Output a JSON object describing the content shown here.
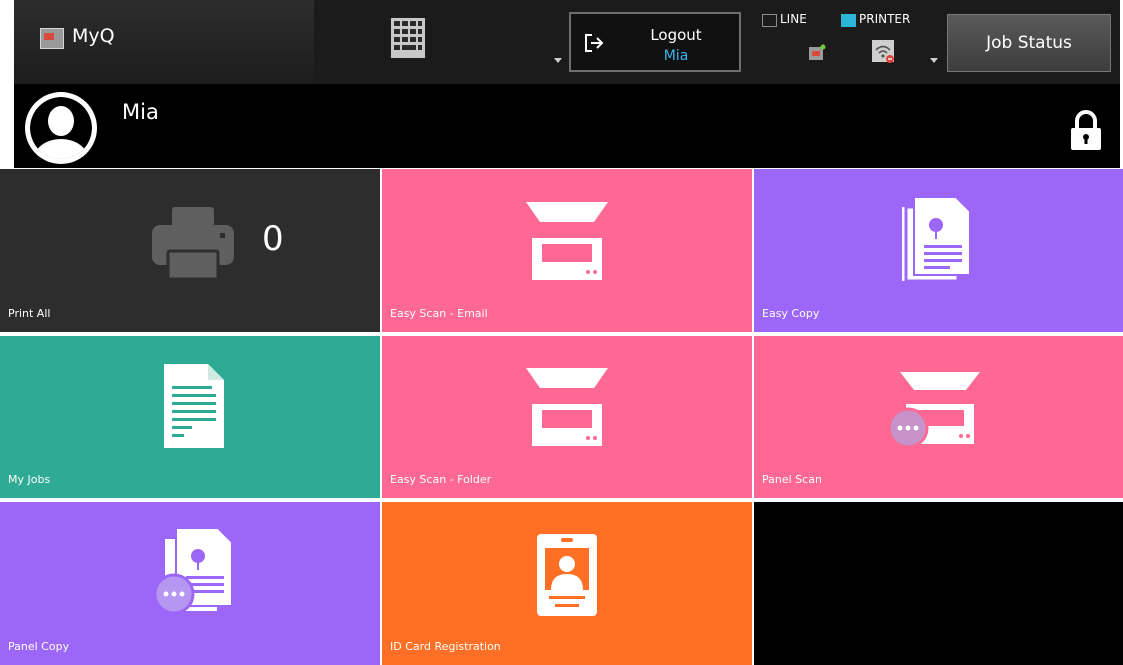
{
  "app": {
    "title": "MyQ"
  },
  "header": {
    "logout_label": "Logout",
    "logout_user": "Mia",
    "indicators": [
      {
        "label": "LINE",
        "active": false
      },
      {
        "label": "PRINTER",
        "active": true
      }
    ],
    "job_status_label": "Job Status"
  },
  "user": {
    "name": "Mia"
  },
  "tiles": {
    "print_all": {
      "label": "Print All",
      "count": "0",
      "color": "#2d2d2d"
    },
    "easy_scan_email": {
      "label": "Easy Scan - Email",
      "color": "#fe6894"
    },
    "easy_copy": {
      "label": "Easy Copy",
      "color": "#9c67f8"
    },
    "my_jobs": {
      "label": "My Jobs",
      "color": "#2eaa95"
    },
    "easy_scan_folder": {
      "label": "Easy Scan - Folder",
      "color": "#fe6894"
    },
    "panel_scan": {
      "label": "Panel Scan",
      "color": "#fe6894"
    },
    "panel_copy": {
      "label": "Panel Copy",
      "color": "#9c67f8"
    },
    "id_card_registration": {
      "label": "ID Card Registration",
      "color": "#ff7026"
    }
  },
  "icons": {
    "app": "myq-app-icon",
    "keypad": "keypad-icon",
    "logout": "logout-icon",
    "line": "device-icon",
    "printer": "wifi-printer-icon",
    "avatar": "user-avatar-icon",
    "lock": "lock-icon"
  }
}
